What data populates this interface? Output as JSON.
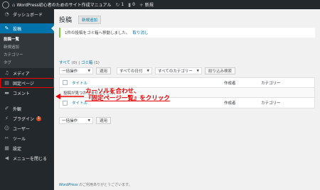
{
  "adminbar": {
    "site_name": "WordPress初心者のためのサイト作成マニュアル",
    "updates_count": "1",
    "comments_count": "0",
    "new_label": "新規"
  },
  "sidebar": {
    "dashboard": "ダッシュボード",
    "posts": "投稿",
    "posts_sub": [
      "投稿一覧",
      "新規追加",
      "カテゴリー",
      "タグ"
    ],
    "media": "メディア",
    "pages": "固定ページ",
    "comments": "コメント",
    "appearance": "外観",
    "plugins": "プラグイン",
    "plugins_badge": "1",
    "users": "ユーザー",
    "tools": "ツール",
    "settings": "設定",
    "collapse": "メニューを閉じる"
  },
  "main": {
    "page_title": "投稿",
    "add_new": "新規追加",
    "notice_text": "1件の投稿をゴミ箱へ移動しました。",
    "notice_undo": "取り消し",
    "filter_all": "すべて",
    "filter_all_count": "(0)",
    "filter_sep": "|",
    "filter_trash": "ゴミ箱",
    "filter_trash_count": "(1)",
    "bulk_action": "一括操作",
    "apply": "適用",
    "all_dates": "すべての日付",
    "all_categories": "すべてのカテゴリー",
    "filter_button": "絞り込み検索",
    "col_title": "タイトル",
    "col_author": "作成者",
    "col_category": "カテゴリー",
    "empty_message": "投稿が見つかりませんでした。"
  },
  "footer": {
    "wp": "WordPress",
    "thanks": " のご利用ありがとうございます。"
  },
  "annotation": {
    "line1": "カーソルを合わせ、",
    "line2": "『固定ページ一覧』をクリック"
  },
  "colors": {
    "admin_dark": "#23282d",
    "accent_blue": "#0073aa",
    "annotation_red": "#e00000",
    "notice_green": "#7ad03a"
  }
}
